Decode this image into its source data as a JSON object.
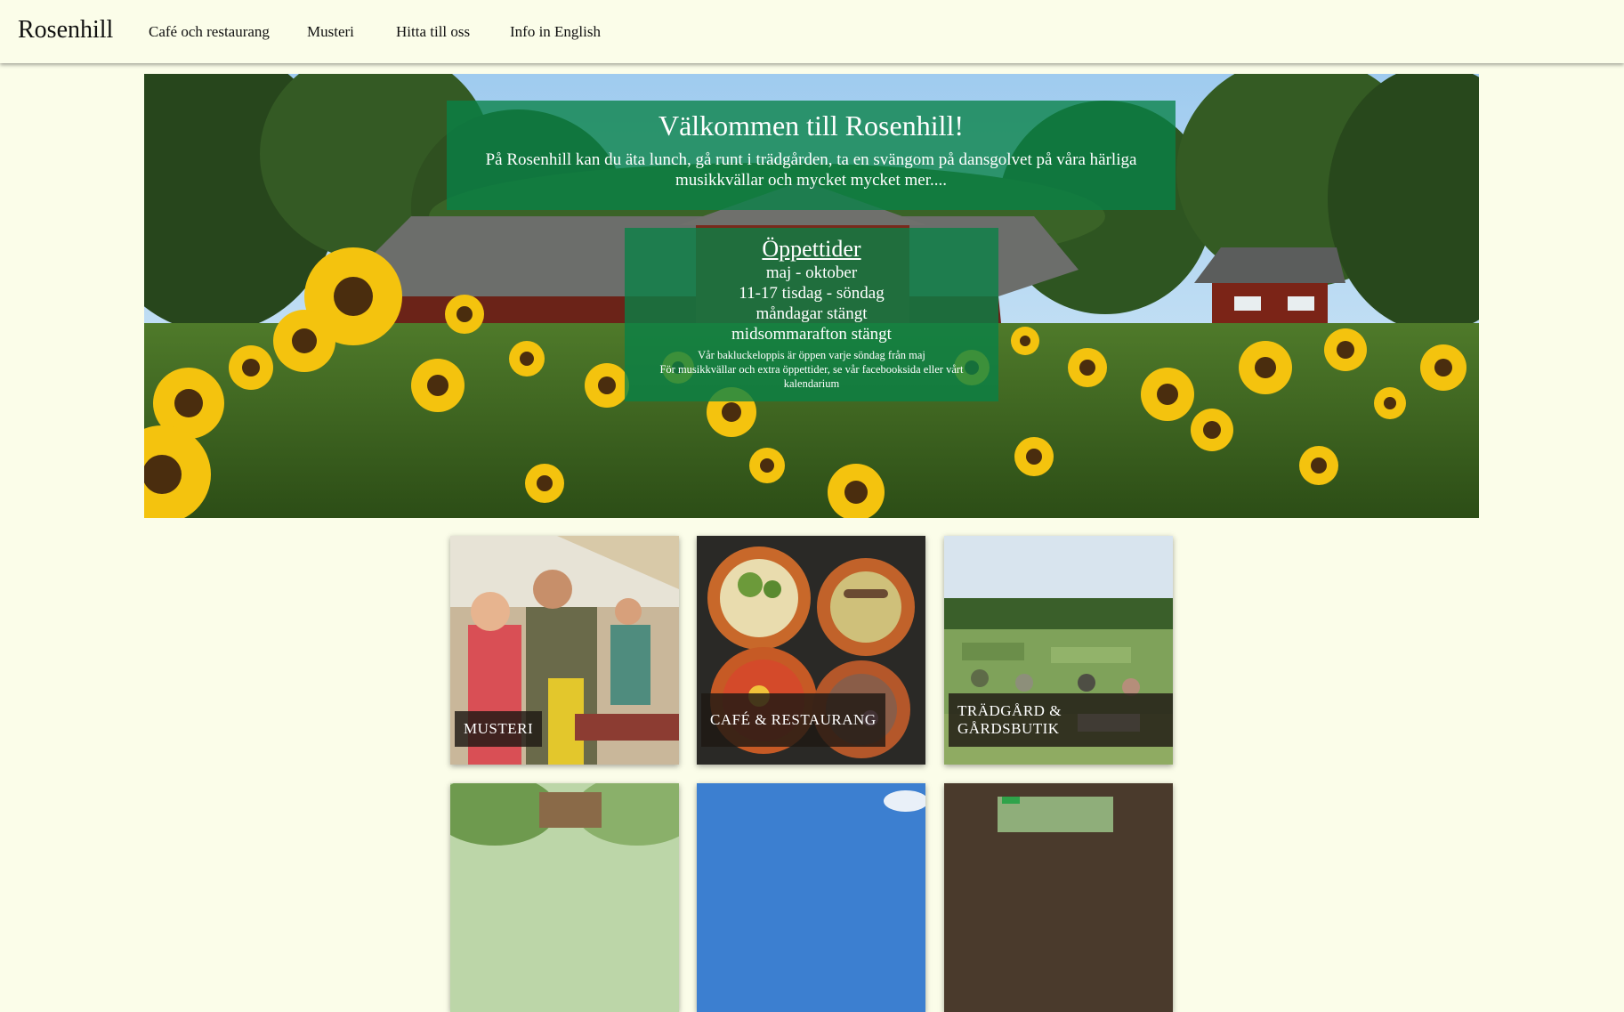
{
  "nav": {
    "brand": "Rosenhill",
    "items": [
      {
        "label": "Café och restaurang"
      },
      {
        "label": "Musteri"
      },
      {
        "label": "Hitta till oss"
      },
      {
        "label": "Info in English"
      }
    ]
  },
  "hero": {
    "title": "Välkommen till Rosenhill!",
    "text": "På Rosenhill kan du äta lunch, gå runt i trädgården, ta en svängom på dansgolvet på våra härliga musikkvällar och mycket mycket mer....",
    "hours": {
      "title": "Öppettider",
      "lines": [
        "maj - oktober",
        "11-17 tisdag - söndag",
        "måndagar stängt",
        "midsommarafton stängt"
      ],
      "note1": "Vår bakluckeloppis är öppen varje söndag från maj",
      "note2_prefix": "För musikkvällar och extra öppettider, se vår",
      "note2_link1": "facebooksida",
      "note2_mid": "eller vårt",
      "note2_link2": "kalendarium"
    }
  },
  "tiles": [
    {
      "label": "MUSTERI"
    },
    {
      "label": "CAFÉ & RESTAURANG"
    },
    {
      "label": "TRÄDGÅRD & GÅRDSBUTIK"
    }
  ],
  "colors": {
    "background": "#fbfde9",
    "overlay_green": "#088246"
  }
}
